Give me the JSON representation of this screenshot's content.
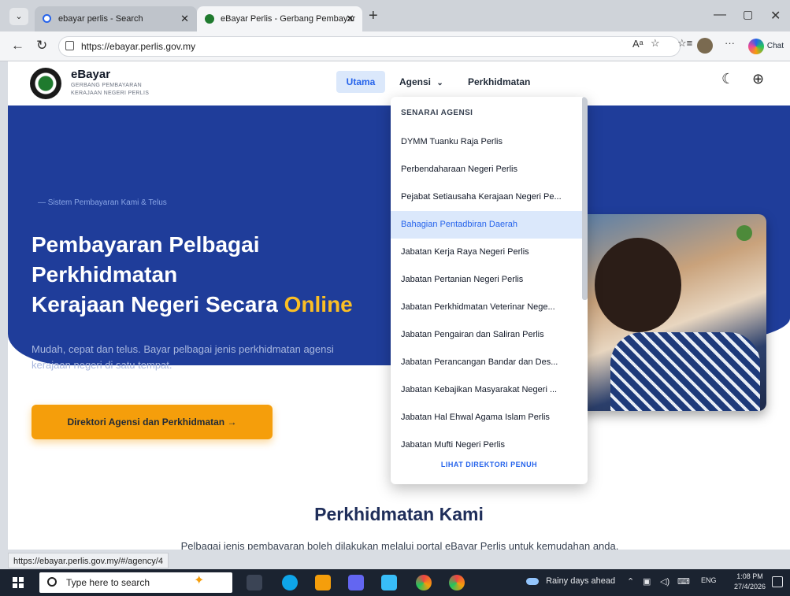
{
  "browser": {
    "tabs": [
      {
        "title": "ebayar perlis - Search"
      },
      {
        "title": "eBayar Perlis - Gerbang Pembayar"
      }
    ],
    "url": "https://ebayar.perlis.gov.my",
    "copilot_label": "Chat",
    "status_url": "https://ebayar.perlis.gov.my/#/agency/4"
  },
  "site": {
    "brand_title": "eBayar",
    "brand_sub1": "GERBANG PEMBAYARAN",
    "brand_sub2": "KERAJAAN NEGERI PERLIS",
    "nav": {
      "utama": "Utama",
      "agensi": "Agensi",
      "perkhidmatan": "Perkhidmatan"
    }
  },
  "hero": {
    "kicker": "— Sistem Pembayaran Kami & Telus",
    "title_line1": "Pembayaran Pelbagai",
    "title_line2": "Perkhidmatan",
    "title_line3": "Kerajaan Negeri Secara",
    "title_accent": "Online",
    "description": "Mudah, cepat dan telus. Bayar pelbagai jenis perkhidmatan agensi kerajaan negeri di satu tempat.",
    "cta_label": "Direktori Agensi dan Perkhidmatan →"
  },
  "dropdown": {
    "header": "SENARAI AGENSI",
    "items": [
      {
        "label": "DYMM Tuanku Raja Perlis"
      },
      {
        "label": "Perbendaharaan Negeri Perlis"
      },
      {
        "label": "Pejabat Setiausaha Kerajaan Negeri Pe..."
      },
      {
        "label": "Bahagian Pentadbiran Daerah"
      },
      {
        "label": "Jabatan Kerja Raya Negeri Perlis"
      },
      {
        "label": "Jabatan Pertanian Negeri Perlis"
      },
      {
        "label": "Jabatan Perkhidmatan Veterinar Nege..."
      },
      {
        "label": "Jabatan Pengairan dan Saliran Perlis"
      },
      {
        "label": "Jabatan Perancangan Bandar dan Des..."
      },
      {
        "label": "Jabatan Kebajikan Masyarakat Negeri ..."
      },
      {
        "label": "Jabatan Hal Ehwal Agama Islam Perlis"
      },
      {
        "label": "Jabatan Mufti Negeri Perlis"
      }
    ],
    "footer": "LIHAT DIREKTORI PENUH"
  },
  "services": {
    "title": "Perkhidmatan Kami",
    "description": "Pelbagai jenis pembayaran boleh dilakukan melalui portal eBayar Perlis untuk kemudahan anda."
  },
  "taskbar": {
    "search_placeholder": "Type here to search",
    "weather": "Rainy days ahead",
    "lang": "ENG",
    "time": "1:08 PM",
    "date": "27/4/2026"
  }
}
